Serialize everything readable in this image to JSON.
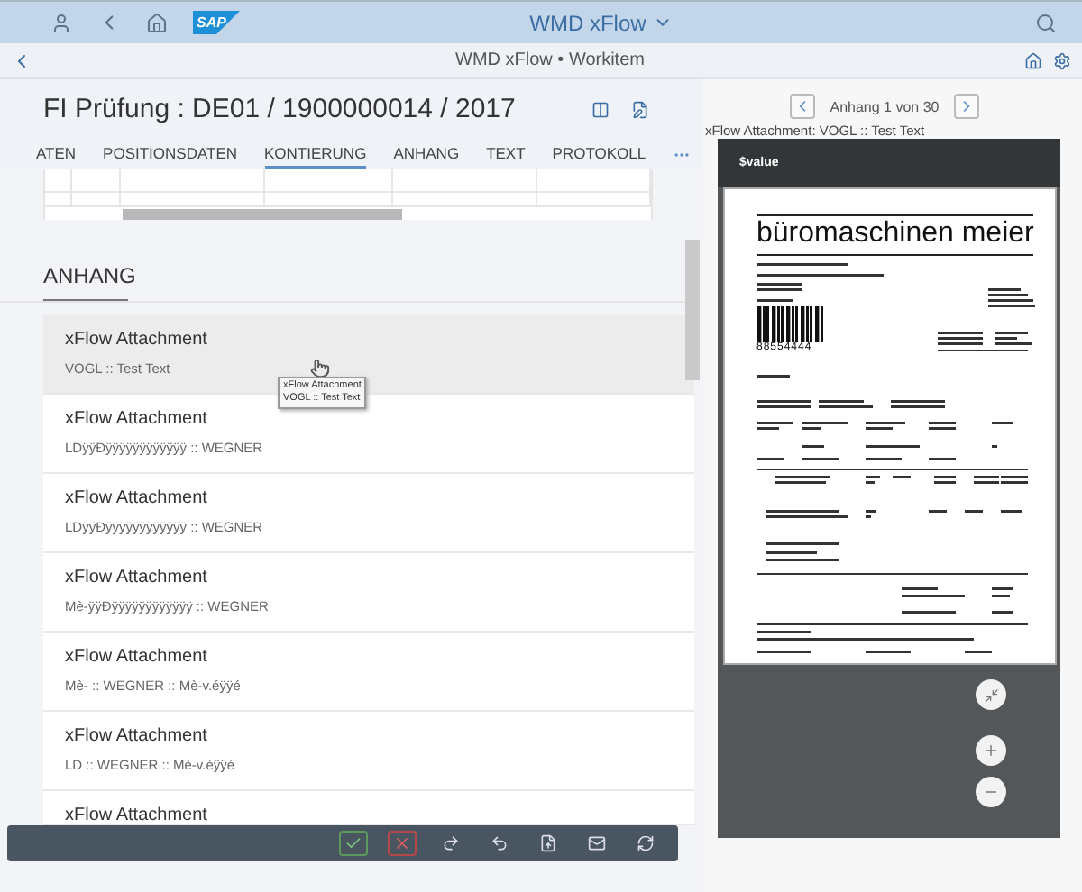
{
  "shell": {
    "logo": "SAP",
    "title": "WMD xFlow"
  },
  "page_header": {
    "title": "WMD xFlow • Workitem"
  },
  "object": {
    "title": "FI Prüfung : DE01 / 1900000014 / 2017"
  },
  "tabs": [
    {
      "label": "ATEN",
      "selected": false
    },
    {
      "label": "POSITIONSDATEN",
      "selected": false
    },
    {
      "label": "KONTIERUNG",
      "selected": true
    },
    {
      "label": "ANHANG",
      "selected": false
    },
    {
      "label": "TEXT",
      "selected": false
    },
    {
      "label": "PROTOKOLL",
      "selected": false
    }
  ],
  "section": {
    "title": "ANHANG"
  },
  "attachments": [
    {
      "title": "xFlow Attachment",
      "subtitle": "VOGL :: Test Text",
      "selected": true
    },
    {
      "title": "xFlow Attachment",
      "subtitle": "LDÿÿÐÿÿÿÿÿÿÿÿÿÿÿÿ :: WEGNER",
      "selected": false
    },
    {
      "title": "xFlow Attachment",
      "subtitle": "LDÿÿÐÿÿÿÿÿÿÿÿÿÿÿÿ :: WEGNER",
      "selected": false
    },
    {
      "title": "xFlow Attachment",
      "subtitle": "Mè-ÿÿÐÿÿÿÿÿÿÿÿÿÿÿÿ :: WEGNER",
      "selected": false
    },
    {
      "title": "xFlow Attachment",
      "subtitle": "Mè- :: WEGNER :: Mè-v.éÿÿé",
      "selected": false
    },
    {
      "title": "xFlow Attachment",
      "subtitle": "LD :: WEGNER :: Mè-v.éÿÿé",
      "selected": false
    },
    {
      "title": "xFlow Attachment",
      "selected": false
    }
  ],
  "tooltip": {
    "lines": [
      "xFlow Attachment",
      "VOGL :: Test Text"
    ]
  },
  "preview": {
    "pager": "Anhang 1 von 30",
    "caption": "xFlow Attachment: VOGL :: Test Text",
    "header": "$value",
    "document": {
      "company": "büromaschinen meier",
      "barcode_number": "88554444"
    }
  }
}
